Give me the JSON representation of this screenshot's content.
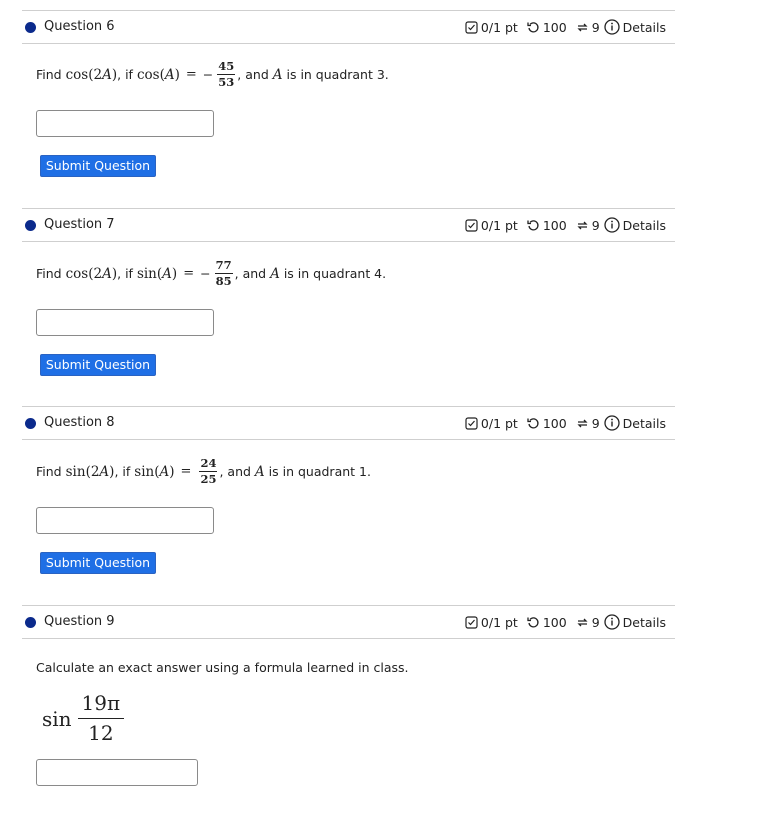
{
  "meta": {
    "score": "0/1 pt",
    "attempts": "100",
    "versions": "9",
    "details": "Details"
  },
  "submit_label": "Submit Question",
  "questions": [
    {
      "title": "Question 6",
      "find_fn": "cos",
      "given_fn": "cos",
      "num": "45",
      "den": "53",
      "negative": true,
      "quadrant_text": "is in quadrant 3."
    },
    {
      "title": "Question 7",
      "find_fn": "cos",
      "given_fn": "sin",
      "num": "77",
      "den": "85",
      "negative": true,
      "quadrant_text": "is in quadrant 4."
    },
    {
      "title": "Question 8",
      "find_fn": "sin",
      "given_fn": "sin",
      "num": "24",
      "den": "25",
      "negative": false,
      "quadrant_text": "is in quadrant 1."
    },
    {
      "title": "Question 9",
      "instruction": "Calculate an exact answer using a formula learned in class.",
      "fn": "sin",
      "num": "19π",
      "den": "12"
    }
  ],
  "text": {
    "find": "Find",
    "if": "if",
    "and": "and"
  },
  "colors": {
    "accent": "#0b2a8c",
    "button": "#1f6fe5"
  }
}
